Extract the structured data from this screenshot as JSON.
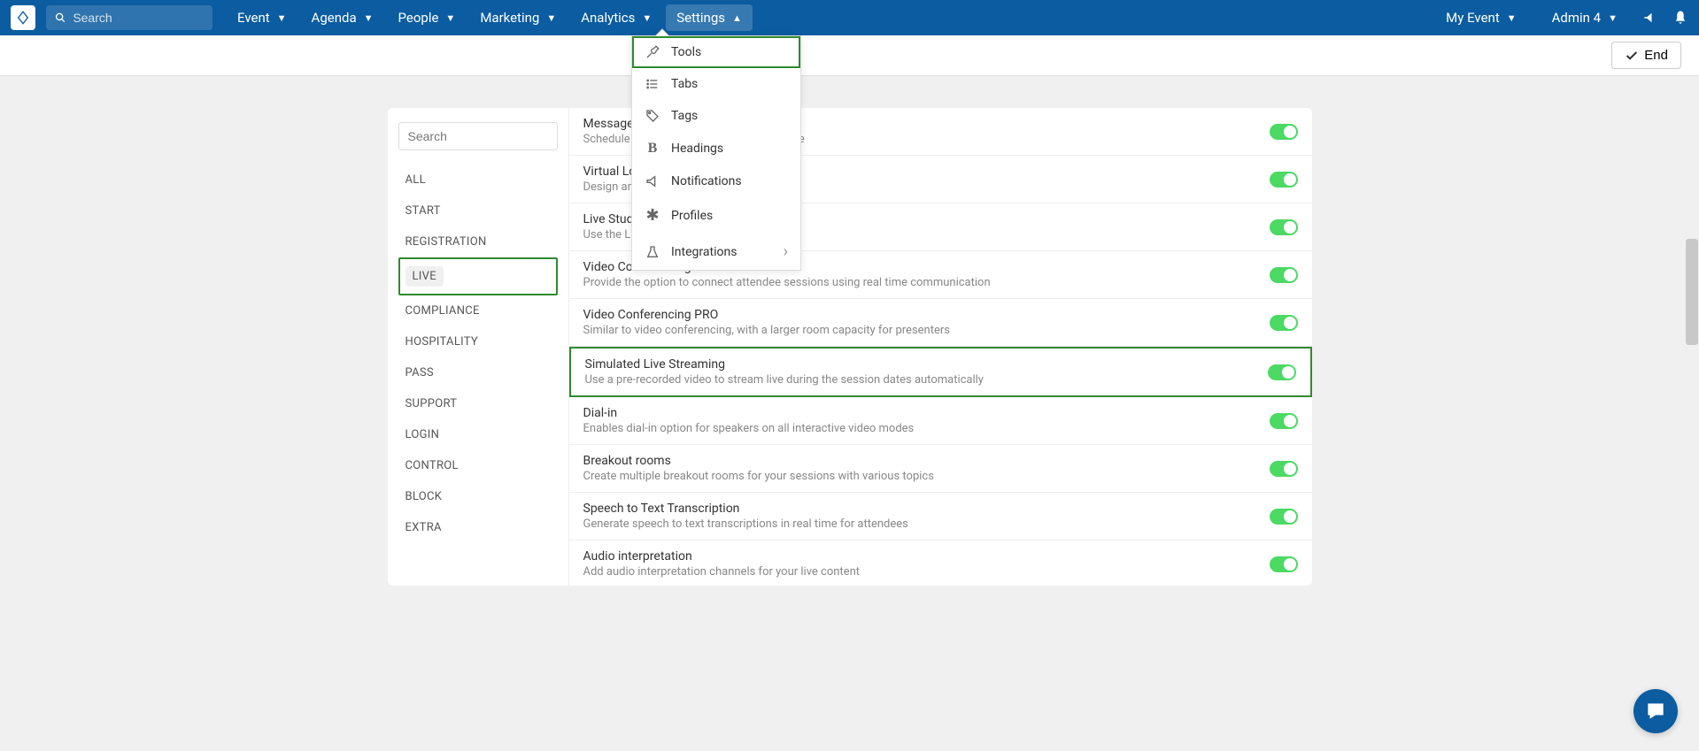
{
  "topbar": {
    "search_placeholder": "Search",
    "nav": [
      {
        "label": "Event"
      },
      {
        "label": "Agenda"
      },
      {
        "label": "People"
      },
      {
        "label": "Marketing"
      },
      {
        "label": "Analytics"
      },
      {
        "label": "Settings",
        "active": true
      }
    ],
    "event_label": "My Event",
    "user_label": "Admin 4"
  },
  "subbar": {
    "end_label": "End"
  },
  "dropdown": {
    "items": [
      {
        "label": "Tools",
        "icon": "wrench",
        "highlighted": true
      },
      {
        "label": "Tabs",
        "icon": "list"
      },
      {
        "label": "Tags",
        "icon": "tag"
      },
      {
        "label": "Headings",
        "icon": "bold"
      },
      {
        "label": "Notifications",
        "icon": "megaphone"
      },
      {
        "label": "Profiles",
        "icon": "asterisk"
      },
      {
        "label": "Integrations",
        "icon": "flask",
        "submenu": true
      }
    ]
  },
  "sidebar": {
    "search_placeholder": "Search",
    "items": [
      {
        "label": "ALL"
      },
      {
        "label": "START"
      },
      {
        "label": "REGISTRATION"
      },
      {
        "label": "LIVE",
        "active": true,
        "highlighted": true
      },
      {
        "label": "COMPLIANCE"
      },
      {
        "label": "HOSPITALITY"
      },
      {
        "label": "PASS"
      },
      {
        "label": "SUPPORT"
      },
      {
        "label": "LOGIN"
      },
      {
        "label": "CONTROL"
      },
      {
        "label": "BLOCK"
      },
      {
        "label": "EXTRA"
      }
    ]
  },
  "settings": [
    {
      "title": "Messages scheduling",
      "desc": "Schedule all your messages prior to the eve",
      "on": true
    },
    {
      "title": "Virtual Lobby",
      "desc": "Design an innovative online lobby for activi",
      "on": true
    },
    {
      "title": "Live Studio",
      "desc": "Use the Live Studio to produce, display and",
      "on": true
    },
    {
      "title": "Video Conferencing",
      "desc": "Provide the option to connect attendee sessions using real time communication",
      "on": true
    },
    {
      "title": "Video Conferencing PRO",
      "desc": "Similar to video conferencing, with a larger room capacity for presenters",
      "on": true
    },
    {
      "title": "Simulated Live Streaming",
      "desc": "Use a pre-recorded video to stream live during the session dates automatically",
      "on": true,
      "highlighted": true
    },
    {
      "title": "Dial-in",
      "desc": "Enables dial-in option for speakers on all interactive video modes",
      "on": true
    },
    {
      "title": "Breakout rooms",
      "desc": "Create multiple breakout rooms for your sessions with various topics",
      "on": true
    },
    {
      "title": "Speech to Text Transcription",
      "desc": "Generate speech to text transcriptions in real time for attendees",
      "on": true
    },
    {
      "title": "Audio interpretation",
      "desc": "Add audio interpretation channels for your live content",
      "on": true
    }
  ]
}
